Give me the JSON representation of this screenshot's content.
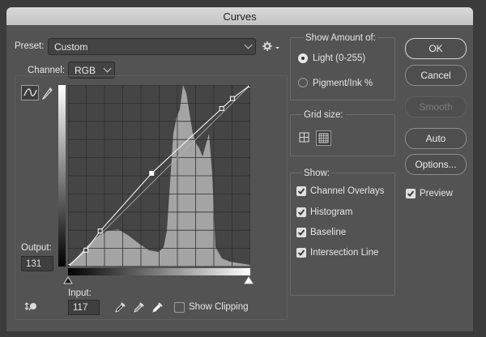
{
  "window": {
    "title": "Curves"
  },
  "preset": {
    "label": "Preset:",
    "value": "Custom"
  },
  "channel": {
    "label": "Channel:",
    "value": "RGB"
  },
  "show_amount": {
    "title": "Show Amount of:",
    "light": "Light  (0-255)",
    "pigment": "Pigment/Ink %",
    "selected": "light"
  },
  "grid_size": {
    "title": "Grid size:"
  },
  "show": {
    "title": "Show:",
    "items": [
      "Channel Overlays",
      "Histogram",
      "Baseline",
      "Intersection Line"
    ]
  },
  "buttons": {
    "ok": "OK",
    "cancel": "Cancel",
    "smooth": "Smooth",
    "auto": "Auto",
    "options": "Options..."
  },
  "preview": {
    "label": "Preview",
    "checked": true
  },
  "output": {
    "label": "Output:",
    "value": "131"
  },
  "input": {
    "label": "Input:",
    "value": "117"
  },
  "show_clipping": {
    "label": "Show Clipping",
    "checked": false
  },
  "curve": {
    "points": [
      [
        0,
        0
      ],
      [
        25,
        23
      ],
      [
        45,
        50
      ],
      [
        117,
        131
      ],
      [
        215,
        222
      ],
      [
        230,
        236
      ],
      [
        255,
        255
      ]
    ],
    "selected_point": [
      117,
      131
    ]
  },
  "icons": {
    "gear": "gear-icon",
    "curve_tool": "curve-tool-icon",
    "pencil": "pencil-icon",
    "target_adjust": "target-adjust-icon",
    "black_eyedropper": "black-eyedropper-icon",
    "gray_eyedropper": "gray-eyedropper-icon",
    "white_eyedropper": "white-eyedropper-icon"
  }
}
